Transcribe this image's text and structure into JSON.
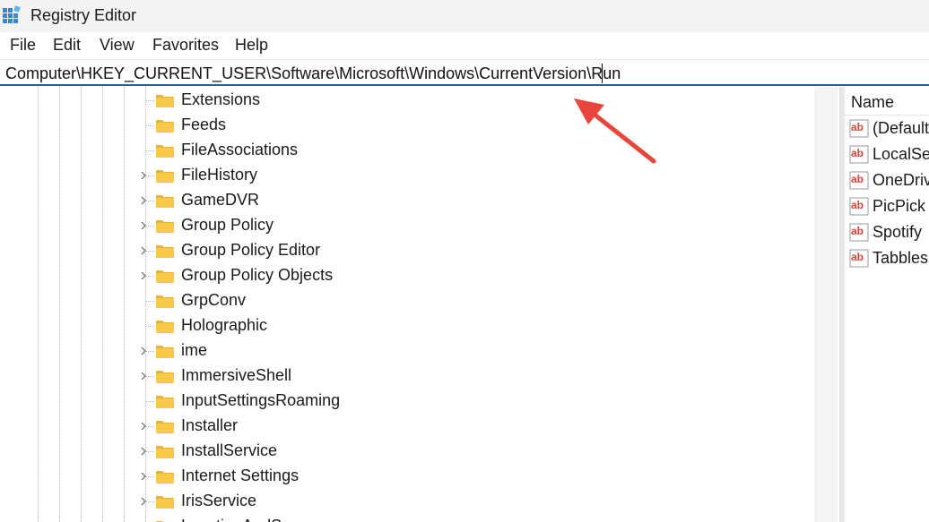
{
  "window": {
    "title": "Registry Editor",
    "app_icon": "registry-editor-icon"
  },
  "menu": {
    "items": [
      "File",
      "Edit",
      "View",
      "Favorites",
      "Help"
    ]
  },
  "address_bar": {
    "value": "Computer\\HKEY_CURRENT_USER\\Software\\Microsoft\\Windows\\CurrentVersion\\Run"
  },
  "tree": {
    "items": [
      {
        "label": "Extensions",
        "expandable": false
      },
      {
        "label": "Feeds",
        "expandable": false
      },
      {
        "label": "FileAssociations",
        "expandable": false
      },
      {
        "label": "FileHistory",
        "expandable": true
      },
      {
        "label": "GameDVR",
        "expandable": true
      },
      {
        "label": "Group Policy",
        "expandable": true
      },
      {
        "label": "Group Policy Editor",
        "expandable": true
      },
      {
        "label": "Group Policy Objects",
        "expandable": true
      },
      {
        "label": "GrpConv",
        "expandable": false
      },
      {
        "label": "Holographic",
        "expandable": false
      },
      {
        "label": "ime",
        "expandable": true
      },
      {
        "label": "ImmersiveShell",
        "expandable": true
      },
      {
        "label": "InputSettingsRoaming",
        "expandable": false
      },
      {
        "label": "Installer",
        "expandable": true
      },
      {
        "label": "InstallService",
        "expandable": true
      },
      {
        "label": "Internet Settings",
        "expandable": true
      },
      {
        "label": "IrisService",
        "expandable": true
      },
      {
        "label": "LocationAndS",
        "expandable": true
      }
    ]
  },
  "values": {
    "header_name": "Name",
    "items": [
      "(Default",
      "LocalSer",
      "OneDriv",
      "PicPick S",
      "Spotify",
      "Tabbles"
    ],
    "value_icon": "string-value-ab-icon"
  },
  "annotation": {
    "arrow_color": "#e8453c",
    "icon": "red-arrow-icon"
  },
  "colors": {
    "folder": "#f8c94a",
    "folder_tab": "#e9b43a",
    "ab_icon": "#d9423a",
    "accent": "#1a64b4"
  }
}
